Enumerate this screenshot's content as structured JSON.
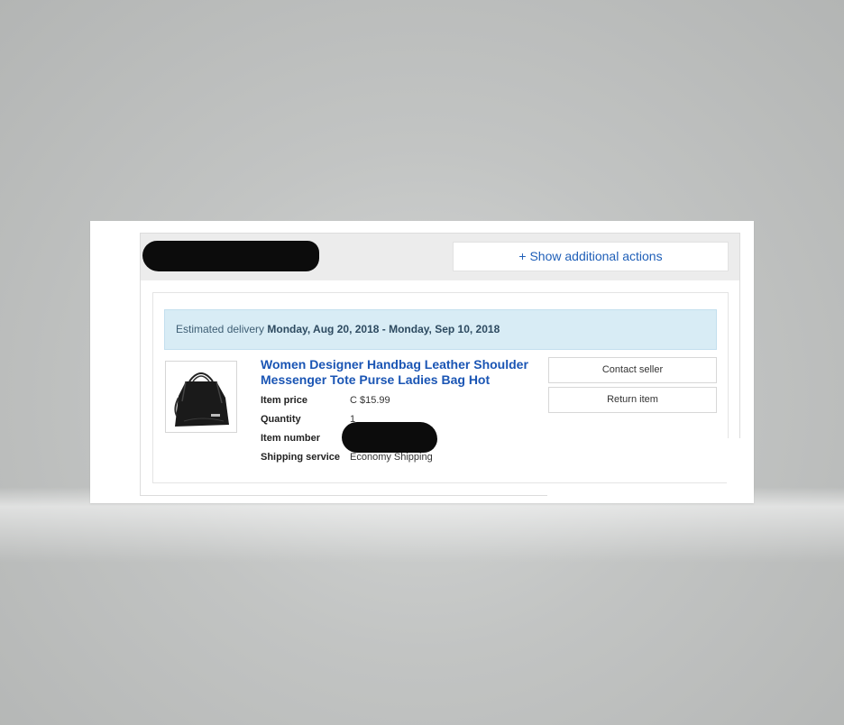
{
  "order": {
    "seller_name_redacted": "",
    "show_actions_label": "+ Show additional actions",
    "delivery": {
      "prefix": "Estimated delivery",
      "dates": "Monday, Aug 20, 2018 - Monday, Sep 10, 2018"
    },
    "item": {
      "image_icon": "handbag-image",
      "title": "Women Designer Handbag Leather Shoulder Messenger Tote Purse Ladies Bag Hot",
      "details": [
        {
          "label": "Item price",
          "value": "C $15.99"
        },
        {
          "label": "Quantity",
          "value": "1"
        },
        {
          "label": "Item number",
          "value": ""
        },
        {
          "label": "Shipping service",
          "value": "Economy Shipping"
        }
      ]
    },
    "buttons": {
      "contact_seller": "Contact seller",
      "return_item": "Return item"
    }
  },
  "colors": {
    "link": "#1a55b4",
    "banner_bg": "#d8ecf5",
    "header_bg": "#ececec",
    "redaction": "#0c0c0c"
  }
}
